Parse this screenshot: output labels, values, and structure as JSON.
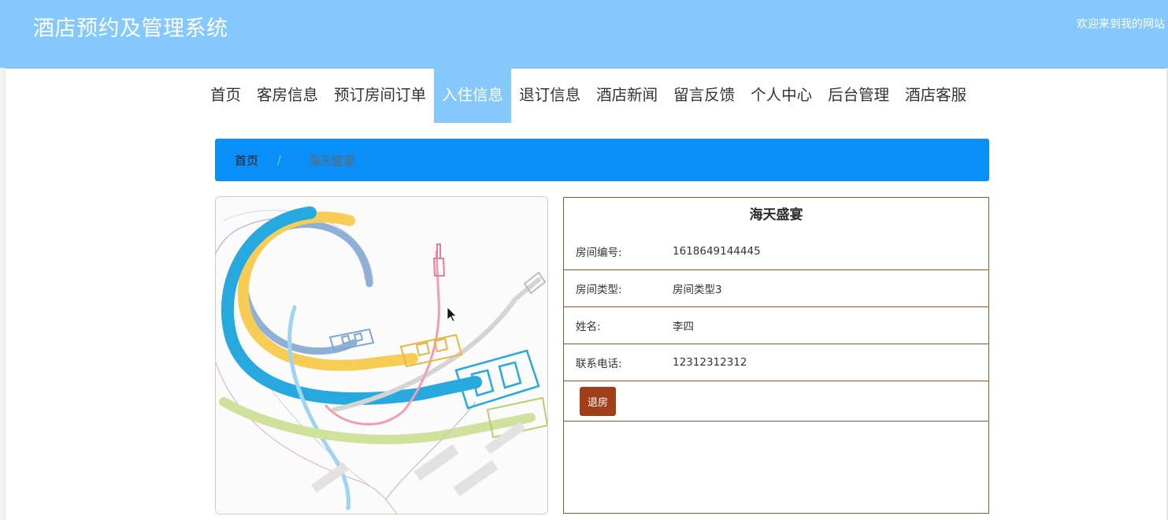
{
  "header": {
    "site_title": "酒店预约及管理系统",
    "welcome": "欢迎来到我的网站"
  },
  "nav": {
    "items": [
      {
        "label": "首页"
      },
      {
        "label": "客房信息"
      },
      {
        "label": "预订房间订单"
      },
      {
        "label": "入住信息",
        "active": true
      },
      {
        "label": "退订信息"
      },
      {
        "label": "酒店新闻"
      },
      {
        "label": "留言反馈"
      },
      {
        "label": "个人中心"
      },
      {
        "label": "后台管理"
      },
      {
        "label": "酒店客服"
      }
    ]
  },
  "breadcrumb": {
    "home": "首页",
    "separator": "/",
    "current": "海天盛宴"
  },
  "detail": {
    "title": "海天盛宴",
    "rows": [
      {
        "label": "房间编号:",
        "value": "1618649144445"
      },
      {
        "label": "房间类型:",
        "value": "房间类型3"
      },
      {
        "label": "姓名:",
        "value": "李四"
      },
      {
        "label": "联系电话:",
        "value": "12312312312"
      }
    ],
    "checkout_label": "退房"
  },
  "colors": {
    "header_bg": "#85c8fb",
    "breadcrumb_bg": "#0a8ff8",
    "panel_border": "#a0522d",
    "button_bg": "#a0401a"
  }
}
